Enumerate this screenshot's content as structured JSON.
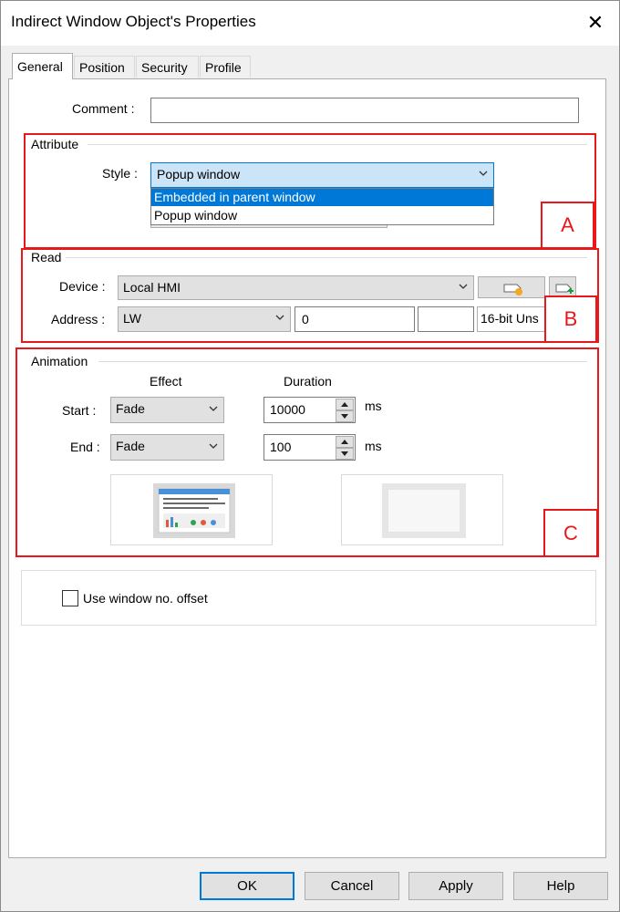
{
  "window": {
    "title": "Indirect Window Object's Properties",
    "close_glyph": "✕"
  },
  "tabs": [
    {
      "label": "General",
      "active": true
    },
    {
      "label": "Position",
      "active": false
    },
    {
      "label": "Security",
      "active": false
    },
    {
      "label": "Profile",
      "active": false
    }
  ],
  "comment": {
    "label": "Comment :",
    "value": ""
  },
  "attribute": {
    "group_label": "Attribute",
    "style_label": "Style :",
    "style_value": "Popup window",
    "style_options": [
      "Embedded in parent window",
      "Popup window"
    ],
    "highlighted_option": "Embedded in parent window"
  },
  "read": {
    "group_label": "Read",
    "device_label": "Device :",
    "device_value": "Local HMI",
    "address_label": "Address :",
    "address_type": "LW",
    "address_value": "0",
    "address_extra": "",
    "data_format": "16-bit Uns"
  },
  "animation": {
    "group_label": "Animation",
    "effect_header": "Effect",
    "duration_header": "Duration",
    "start_label": "Start :",
    "start_effect": "Fade",
    "start_duration": "10000",
    "end_label": "End :",
    "end_effect": "Fade",
    "end_duration": "100",
    "unit": "ms"
  },
  "offset": {
    "label": "Use window no. offset",
    "checked": false
  },
  "annotations": {
    "a": "A",
    "b": "B",
    "c": "C",
    "color": "#e8181a"
  },
  "buttons": {
    "ok": "OK",
    "cancel": "Cancel",
    "apply": "Apply",
    "help": "Help"
  }
}
